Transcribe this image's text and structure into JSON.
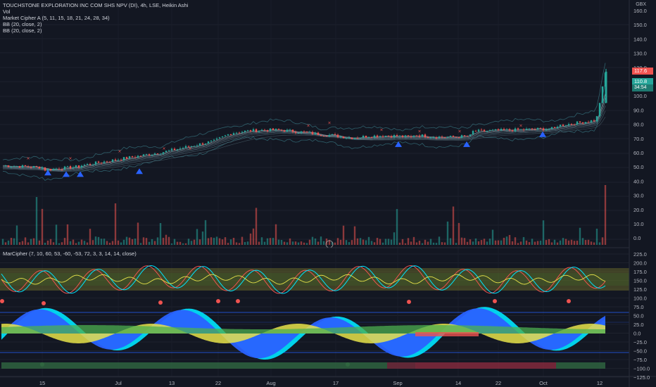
{
  "legend": {
    "title": "TOUCHSTONE EXPLORATION INC COM SHS NPV (DI), 4h, LSE, Heikin Ashi",
    "indicators": [
      "Vol",
      "Market Cipher A (5, 11, 15, 18, 21, 24, 28, 34)",
      "BB (20, close, 2)",
      "BB (20, close, 2)"
    ],
    "sub_indicator": "MarCipher (7, 10, 60, 53, -60, -53, 72, 3, 3, 14, 14, close)"
  },
  "price_axis": {
    "currency": "GBX",
    "ticks": [
      "160.0",
      "150.0",
      "140.0",
      "130.0",
      "120.0",
      "110.0",
      "100.0",
      "90.0",
      "80.0",
      "70.0",
      "60.0",
      "50.0",
      "40.0",
      "30.0",
      "20.0",
      "10.0",
      "0.0"
    ],
    "last_price_red": "117.6",
    "last_price_green": "110.8",
    "countdown": "34:54"
  },
  "osc_axis": {
    "ticks": [
      "225.0",
      "200.0",
      "175.0",
      "150.0",
      "125.0",
      "100.0",
      "75.0",
      "50.0",
      "25.0",
      "0.0",
      "−25.0",
      "−50.0",
      "−75.0",
      "−100.0",
      "−125.0"
    ]
  },
  "time_axis": {
    "labels": [
      "15",
      "Jul",
      "13",
      "22",
      "Aug",
      "17",
      "Sep",
      "14",
      "22",
      "Oct",
      "12"
    ]
  },
  "colors": {
    "background": "#131722",
    "up": "#26a69a",
    "down": "#ef5350",
    "wave_blue": "#2962ff",
    "wave_cyan": "#00e5ff",
    "wave_yellow": "#e8e34a",
    "money_flow_green": "#4caf50",
    "signal_triangle": "#2962ff"
  }
}
